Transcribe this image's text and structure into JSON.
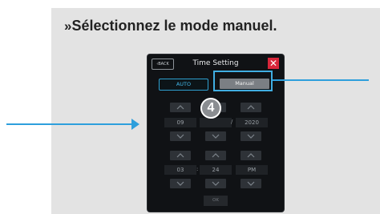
{
  "instruction": {
    "chevron": "»",
    "text": "Sélectionnez le mode manuel."
  },
  "screen": {
    "back_label": "BACK",
    "title": "Time Setting",
    "close_icon": "close-icon",
    "modes": {
      "auto": "AUTO",
      "manual": "Manual"
    },
    "date": {
      "month": "09",
      "day": "",
      "separator": "/",
      "year": "2020"
    },
    "time": {
      "hour": "03",
      "separator": ":",
      "minute": "24",
      "ampm": "PM"
    },
    "ok_label": "OK"
  },
  "step_badge": "4",
  "colors": {
    "accent": "#2e9fdc",
    "panel": "#e3e3e3",
    "close": "#d8263a",
    "screen_bg": "#101215"
  }
}
